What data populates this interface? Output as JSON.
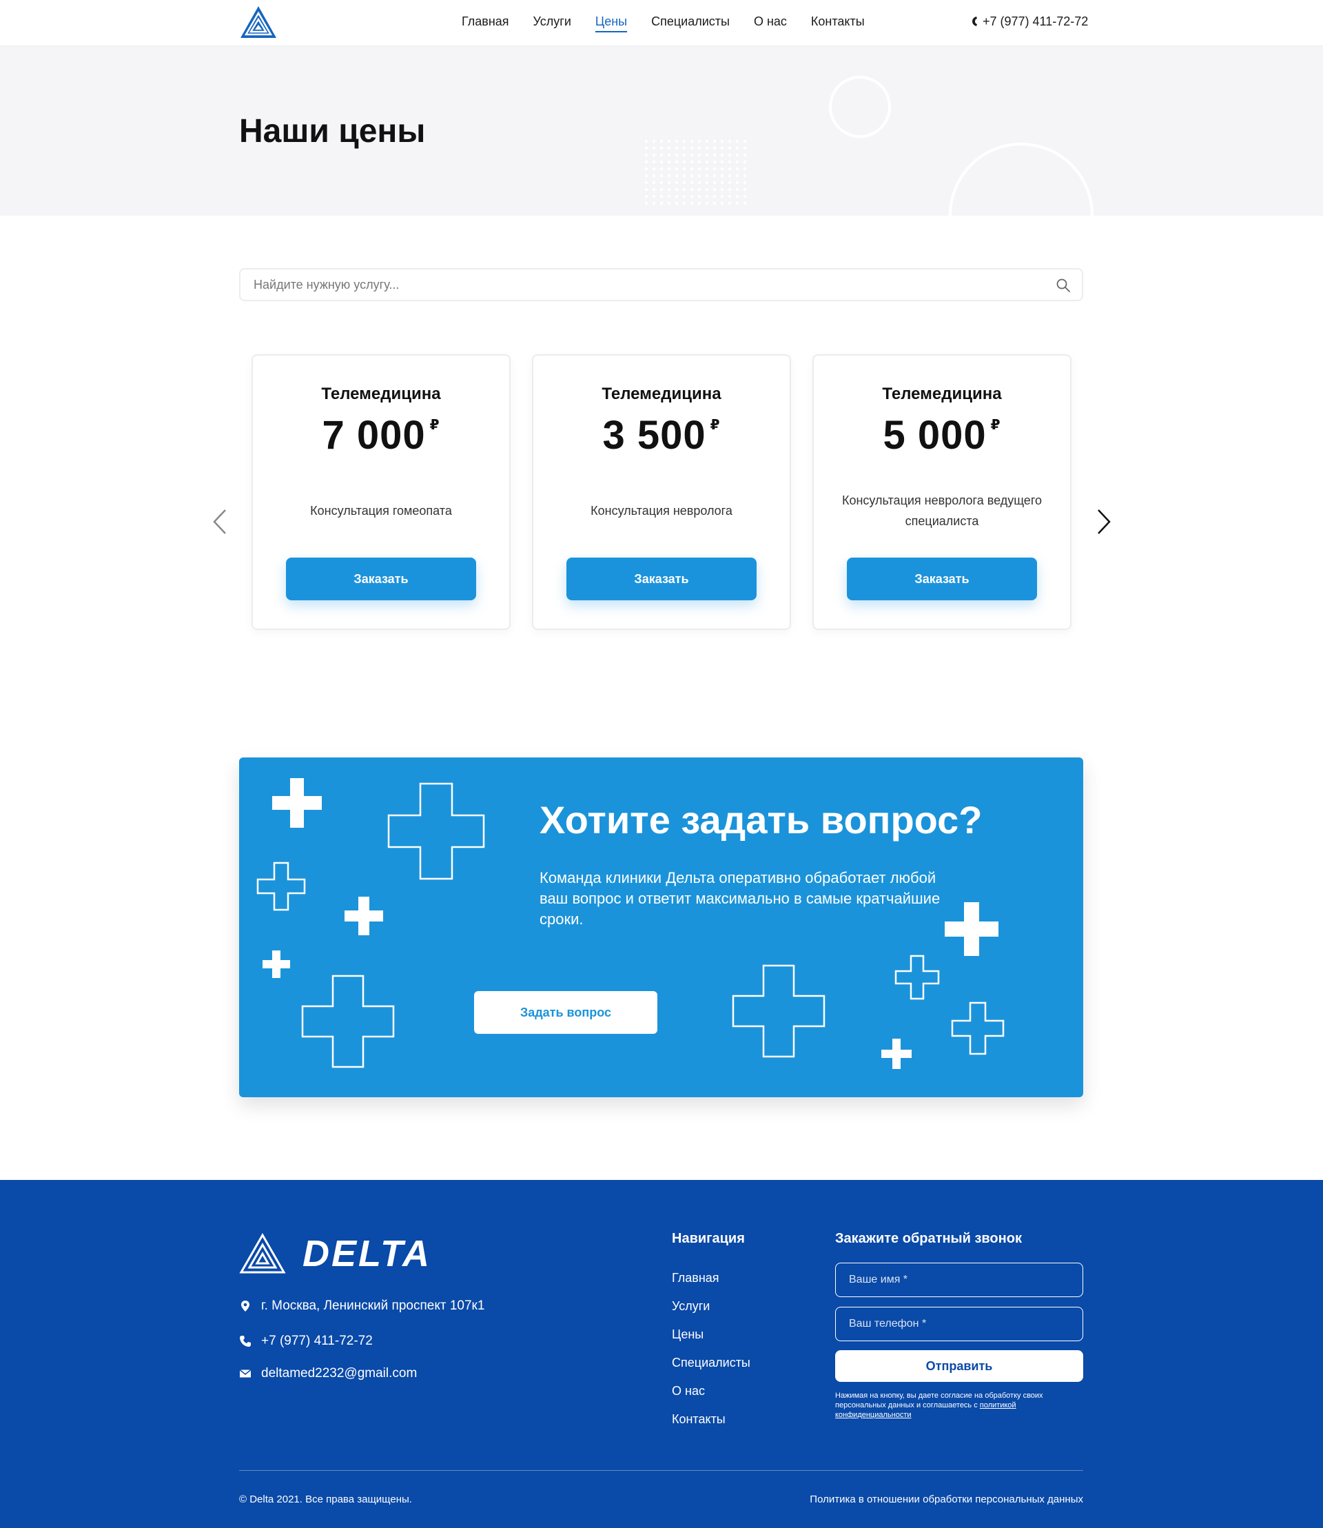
{
  "header": {
    "nav": [
      {
        "label": "Главная",
        "active": false
      },
      {
        "label": "Услуги",
        "active": false
      },
      {
        "label": "Цены",
        "active": true
      },
      {
        "label": "Специалисты",
        "active": false
      },
      {
        "label": "О нас",
        "active": false
      },
      {
        "label": "Контакты",
        "active": false
      }
    ],
    "phone": "+7 (977) 411-72-72"
  },
  "hero": {
    "title": "Наши цены"
  },
  "search": {
    "placeholder": "Найдите нужную услугу..."
  },
  "cards": [
    {
      "title": "Телемедицина",
      "price": "7 000",
      "currency": "₽",
      "description": "Консультация гомеопата",
      "button": "Заказать"
    },
    {
      "title": "Телемедицина",
      "price": "3 500",
      "currency": "₽",
      "description": "Консультация невролога",
      "button": "Заказать"
    },
    {
      "title": "Телемедицина",
      "price": "5 000",
      "currency": "₽",
      "description": "Консультация невролога ведущего специалиста",
      "button": "Заказать"
    }
  ],
  "banner": {
    "title": "Хотите задать вопрос?",
    "text": "Команда клиники Дельта оперативно обработает любой ваш вопрос и ответит максимально в самые кратчайшие сроки.",
    "button": "Задать вопрос"
  },
  "footer": {
    "brand": "DELTA",
    "address": "г. Москва, Ленинский проспект 107к1",
    "phone": "+7 (977) 411-72-72",
    "email": "deltamed2232@gmail.com",
    "nav_title": "Навигация",
    "nav": [
      "Главная",
      "Услуги",
      "Цены",
      "Специалисты",
      "О нас",
      "Контакты"
    ],
    "callback_title": "Закажите обратный звонок",
    "name_placeholder": "Ваше имя *",
    "phone_placeholder": "Ваш телефон *",
    "submit": "Отправить",
    "consent_text": "Нажимая на кнопку, вы даете согласие на обработку своих персональных данных и соглашаетесь с ",
    "consent_link": "политикой конфиденциальности",
    "copyright": "© Delta 2021. Все права защищены.",
    "policy": "Политика в отношении обработки персональных данных"
  },
  "colors": {
    "accent": "#1b93da",
    "brand_dark": "#0a4aa8",
    "active_nav": "#1565c0",
    "hero_bg": "#f5f5f7"
  },
  "icons": [
    "logo-triangle",
    "phone-icon",
    "search-icon",
    "chevron-left-icon",
    "chevron-right-icon",
    "location-pin-icon",
    "envelope-icon",
    "cross-icon"
  ]
}
